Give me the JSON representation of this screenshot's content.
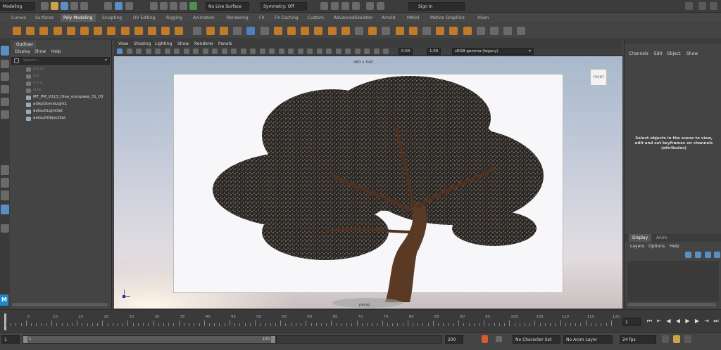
{
  "status_line": {
    "mode": "Modeling",
    "live_surface": "No Live Surface",
    "symmetry": "Symmetry: Off",
    "sign_in": "Sign In"
  },
  "shelf_tabs": [
    "Curves",
    "Surfaces",
    "Poly Modeling",
    "Sculpting",
    "UV Editing",
    "Rigging",
    "Animation",
    "Rendering",
    "FX",
    "FX Caching",
    "Custom",
    "AdvancedSkeleton",
    "Arnold",
    "MASH",
    "Motion Graphics",
    "XGen"
  ],
  "outliner": {
    "title": "Outliner",
    "menu": [
      "Display",
      "Show",
      "Help"
    ],
    "search_placeholder": "Search...",
    "items": [
      {
        "label": "persp",
        "dim": true
      },
      {
        "label": "top",
        "dim": true
      },
      {
        "label": "front",
        "dim": true
      },
      {
        "label": "side",
        "dim": true
      },
      {
        "label": "MT_PM_V113_Olea_europaea_31_03",
        "dim": false
      },
      {
        "label": "aiSkyDomeLight1",
        "dim": false
      },
      {
        "label": "defaultLightSet",
        "dim": false
      },
      {
        "label": "defaultObjectSet",
        "dim": false
      }
    ]
  },
  "viewport": {
    "menu": [
      "View",
      "Shading",
      "Lighting",
      "Show",
      "Renderer",
      "Panels"
    ],
    "resolution": "960 x 540",
    "camera_label": "persp",
    "view_cube": "FRONT",
    "exposure": "0.00",
    "gamma": "1.00",
    "color_space": "sRGB gamma (legacy)"
  },
  "channel_box": {
    "menu": [
      "Channels",
      "Edit",
      "Object",
      "Show"
    ],
    "message": "Select objects in the scene to view, edit and set keyframes on channels (attributes)"
  },
  "layer_editor": {
    "tabs": [
      "Display",
      "Anim"
    ],
    "menu": [
      "Layers",
      "Options",
      "Help"
    ]
  },
  "timeline": {
    "ticks": [
      "5",
      "10",
      "15",
      "20",
      "25",
      "30",
      "35",
      "40",
      "45",
      "50",
      "55",
      "60",
      "65",
      "70",
      "75",
      "80",
      "85",
      "90",
      "95",
      "100",
      "105",
      "110",
      "115",
      "120"
    ],
    "current_frame": "1"
  },
  "range": {
    "start": "1",
    "inner_start": "1",
    "inner_end": "120",
    "end": "200",
    "character_set": "No Character Set",
    "anim_layer": "No Anim Layer",
    "fps": "24 fps"
  },
  "left_rail_logo": "M"
}
